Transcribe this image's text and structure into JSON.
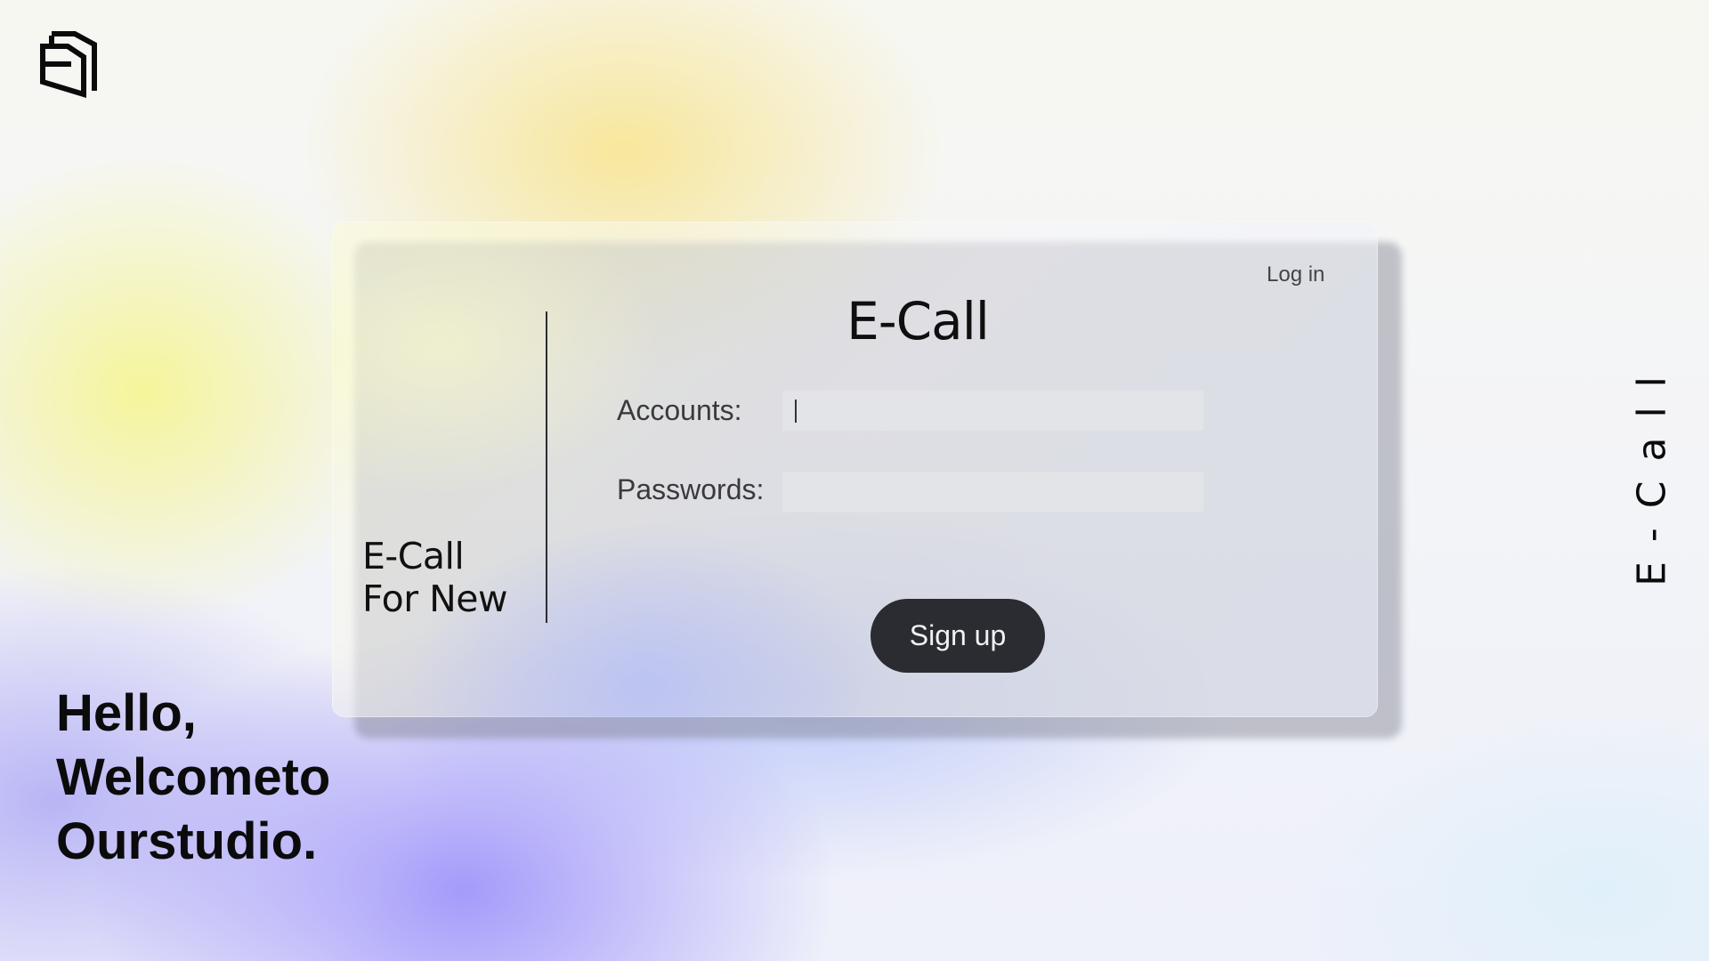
{
  "brand": {
    "logo_icon": "stacked-e-logo-icon"
  },
  "card": {
    "login_label": "Log in",
    "title": "E-Call",
    "tagline_line1": "E-Call",
    "tagline_line2": "For New",
    "accounts_label": "Accounts:",
    "accounts_value": "",
    "passwords_label": "Passwords:",
    "passwords_value": "",
    "signup_label": "Sign up"
  },
  "greeting": {
    "line1": "Hello,",
    "line2": "Welcometo",
    "line3": "Ourstudio."
  },
  "side_text": "E-Call",
  "colors": {
    "button_bg": "#2b2c31",
    "field_bg": "#e3e4e8",
    "text_dark": "#0b0b0c"
  }
}
